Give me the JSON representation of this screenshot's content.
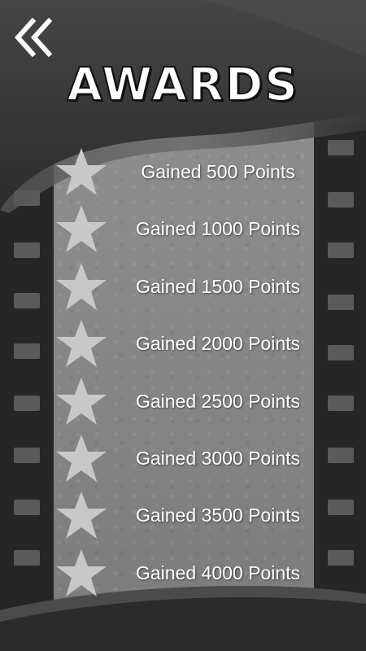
{
  "title": "AWARDS",
  "back_icon": "double-chevron-left-icon",
  "awards": [
    {
      "label": "Gained 500 Points",
      "icon": "star-icon",
      "unlocked": false
    },
    {
      "label": "Gained 1000 Points",
      "icon": "star-icon",
      "unlocked": false
    },
    {
      "label": "Gained 1500 Points",
      "icon": "star-icon",
      "unlocked": false
    },
    {
      "label": "Gained 2000 Points",
      "icon": "star-icon",
      "unlocked": false
    },
    {
      "label": "Gained 2500 Points",
      "icon": "star-icon",
      "unlocked": false
    },
    {
      "label": "Gained 3000 Points",
      "icon": "star-icon",
      "unlocked": false
    },
    {
      "label": "Gained 3500 Points",
      "icon": "star-icon",
      "unlocked": false
    },
    {
      "label": "Gained 4000 Points",
      "icon": "star-icon",
      "unlocked": false
    }
  ],
  "colors": {
    "star": "#c8c8c8",
    "text": "#ffffff",
    "panel": "#888888",
    "film": "#262626"
  }
}
